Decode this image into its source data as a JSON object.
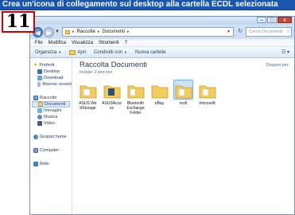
{
  "banner": {
    "text": "Crea un'icona di collegamento sul desktop alla cartella ECDL selezionata"
  },
  "step": {
    "number": "11"
  },
  "window": {
    "buttons": {
      "minimize": "–",
      "maximize": "□",
      "close": "x"
    }
  },
  "address": {
    "back": "◀",
    "forward": "▶",
    "breadcrumbs": [
      "Raccolte",
      "Documenti"
    ],
    "refresh": "↻",
    "search_placeholder": "Cerca Documenti",
    "search_icon": "search-icon"
  },
  "menu": [
    "File",
    "Modifica",
    "Visualizza",
    "Strumenti",
    "?"
  ],
  "toolbar": {
    "organize": "Organizza",
    "open": "Apri",
    "share": "Condividi con",
    "new_folder": "Nuova cartella",
    "view": "☷ ▾"
  },
  "nav": {
    "favorites": "Preferiti",
    "favorites_items": [
      "Desktop",
      "Download",
      "Risorse recenti"
    ],
    "libraries": "Raccolte",
    "libraries_items": [
      "Documenti",
      "Immagini",
      "Musica",
      "Video"
    ],
    "selected": "Documenti",
    "homegroup": "Gruppo home",
    "computer": "Computer",
    "network": "Rete"
  },
  "library": {
    "title": "Raccolta Documenti",
    "subtitle": "Include: 2 percorsi",
    "arrange": "Disponi per:"
  },
  "files": [
    {
      "name": "ASUS WebStorage",
      "selected": false
    },
    {
      "name": "ASUSAccess",
      "selected": false
    },
    {
      "name": "Bluetooth Exchange Folder",
      "selected": false
    },
    {
      "name": "eBay",
      "selected": false
    },
    {
      "name": "ecdl",
      "selected": true
    },
    {
      "name": "microsoft",
      "selected": false
    }
  ],
  "colors": {
    "banner": "#1a56b0",
    "step_border": "#cc0000",
    "folder": "#f2cd5c",
    "selection": "#cce2fb"
  }
}
